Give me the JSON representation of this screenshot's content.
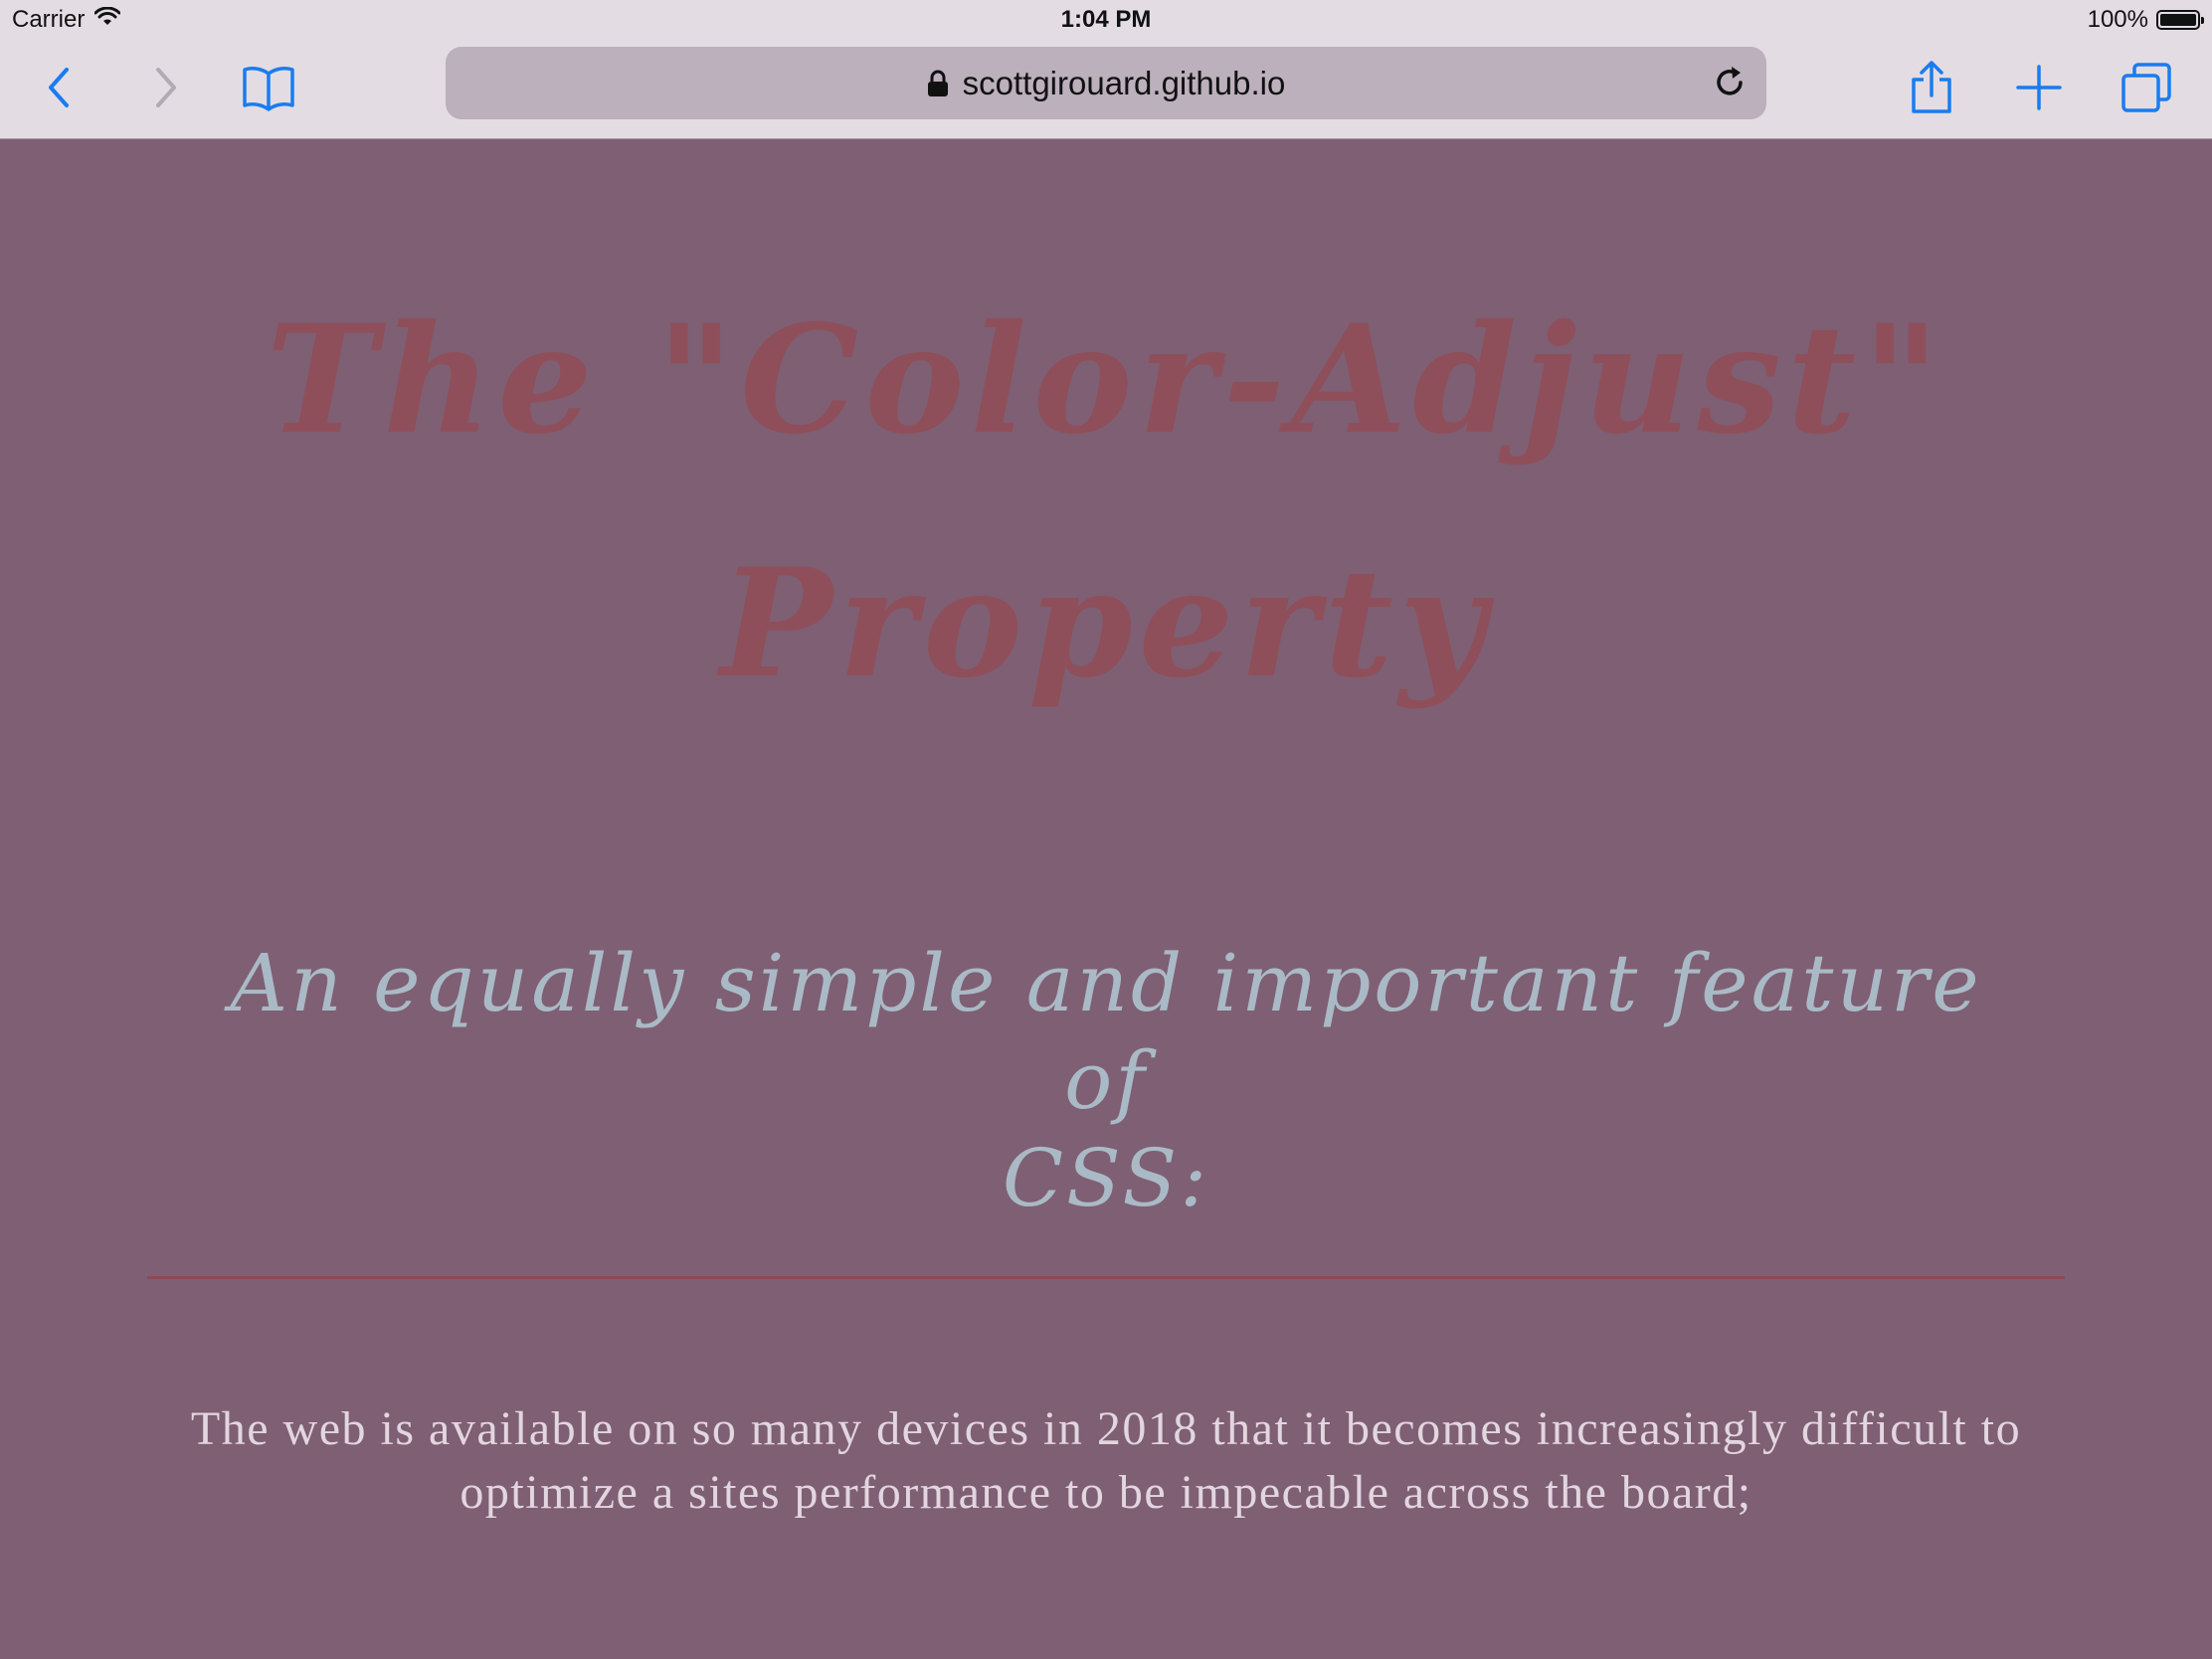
{
  "status_bar": {
    "carrier": "Carrier",
    "time": "1:04 PM",
    "battery_percent": "100%",
    "battery_level": 1.0
  },
  "toolbar": {
    "url": "scottgirouard.github.io",
    "icons": {
      "back": "chevron-left-icon",
      "forward": "chevron-right-icon",
      "bookmarks": "book-icon",
      "lock": "lock-icon",
      "reload": "reload-icon",
      "share": "share-icon",
      "new_tab": "plus-icon",
      "tabs": "tabs-icon"
    },
    "accent_color": "#1a7cf0",
    "disabled_color": "#b3abb3"
  },
  "page": {
    "title_line1": "The \"Color-Adjust\"",
    "title_line2": "Property",
    "subtitle_line1": "An equally simple and important feature of",
    "subtitle_line2": "CSS:",
    "paragraph_line1": "The web is available on so many devices in 2018 that it becomes increasingly difficult to",
    "paragraph_line2": "optimize a sites performance to be impecable across the board;",
    "colors": {
      "background": "#7f5f73",
      "title": "#8e4f5a",
      "subtitle": "#a9bac6",
      "divider": "#8c4a52",
      "body_text": "#e2d6e0"
    }
  }
}
